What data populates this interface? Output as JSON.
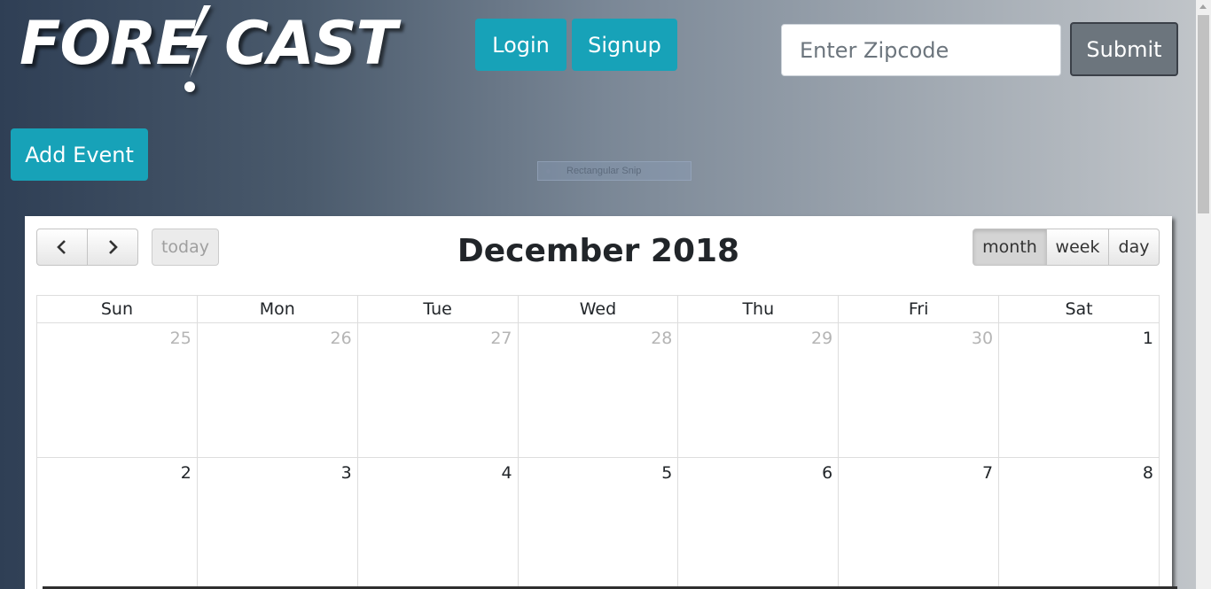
{
  "header": {
    "logo_text_left": "FORE",
    "logo_text_right": "CAST",
    "login_label": "Login",
    "signup_label": "Signup",
    "zipcode_placeholder": "Enter Zipcode",
    "zipcode_value": "",
    "submit_label": "Submit"
  },
  "actions": {
    "add_event_label": "Add Event"
  },
  "overlay": {
    "snip_label": "Rectangular Snip"
  },
  "calendar": {
    "title": "December 2018",
    "today_label": "today",
    "views": [
      "month",
      "week",
      "day"
    ],
    "active_view": "month",
    "weekdays": [
      "Sun",
      "Mon",
      "Tue",
      "Wed",
      "Thu",
      "Fri",
      "Sat"
    ],
    "weeks": [
      [
        {
          "day": "25",
          "other": true
        },
        {
          "day": "26",
          "other": true
        },
        {
          "day": "27",
          "other": true
        },
        {
          "day": "28",
          "other": true
        },
        {
          "day": "29",
          "other": true
        },
        {
          "day": "30",
          "other": true
        },
        {
          "day": "1",
          "other": false
        }
      ],
      [
        {
          "day": "2",
          "other": false
        },
        {
          "day": "3",
          "other": false
        },
        {
          "day": "4",
          "other": false
        },
        {
          "day": "5",
          "other": false
        },
        {
          "day": "6",
          "other": false
        },
        {
          "day": "7",
          "other": false
        },
        {
          "day": "8",
          "other": false
        }
      ]
    ]
  },
  "colors": {
    "accent_teal": "#17a2b8",
    "submit_gray": "#6c757d"
  },
  "icons": {
    "prev": "chevron-left-icon",
    "next": "chevron-right-icon",
    "logo_bolt": "lightning-bolt-icon"
  }
}
